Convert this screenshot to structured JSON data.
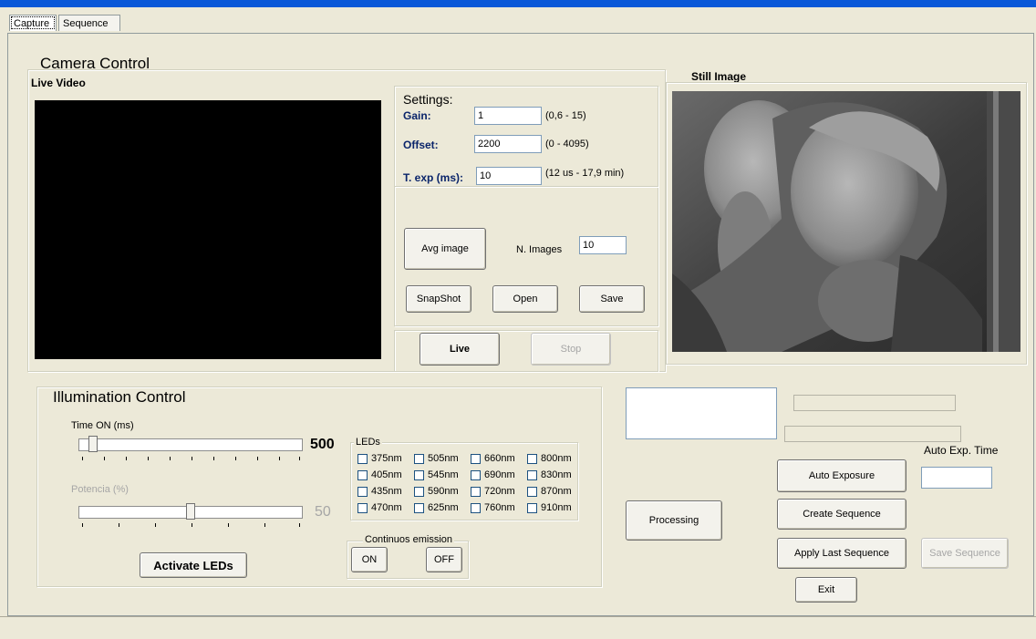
{
  "tabs": [
    "Capture",
    "Sequence"
  ],
  "camera_control": {
    "title": "Camera Control",
    "live_video_label": "Live Video",
    "still_image_label": "Still Image"
  },
  "settings": {
    "title": "Settings:",
    "gain_label": "Gain:",
    "gain_value": "1",
    "gain_range": "(0,6 - 15)",
    "offset_label": "Offset:",
    "offset_value": "2200",
    "offset_range": "(0 - 4095)",
    "texp_label": "T. exp (ms):",
    "texp_value": "10",
    "texp_range": "(12 us - 17,9 min)"
  },
  "capture_buttons": {
    "avg_image": "Avg image",
    "n_images_label": "N. Images",
    "n_images_value": "10",
    "snapshot": "SnapShot",
    "open": "Open",
    "save": "Save",
    "live": "Live",
    "stop": "Stop"
  },
  "illumination": {
    "title": "Illumination Control",
    "time_on_label": "Time ON (ms)",
    "time_on_value": "500",
    "time_on_level": 0.0,
    "potencia_label": "Potencia (%)",
    "potencia_value": "50",
    "potencia_level": 0.5,
    "activate_leds": "Activate LEDs",
    "leds_label": "LEDs",
    "leds": [
      [
        "375nm",
        "505nm",
        "660nm",
        "800nm"
      ],
      [
        "405nm",
        "545nm",
        "690nm",
        "830nm"
      ],
      [
        "435nm",
        "590nm",
        "720nm",
        "870nm"
      ],
      [
        "470nm",
        "625nm",
        "760nm",
        "910nm"
      ]
    ],
    "continuous_label": "Continuos emission",
    "on": "ON",
    "off": "OFF"
  },
  "right_panel": {
    "processing": "Processing",
    "auto_exp_time_label": "Auto Exp. Time",
    "auto_exposure": "Auto Exposure",
    "create_sequence": "Create Sequence",
    "apply_last_sequence": "Apply Last Sequence",
    "save_sequence": "Save Sequence",
    "exit": "Exit"
  },
  "colors": {
    "window_bg": "#ece9d8",
    "label_navy": "#0a246a",
    "title_bar_blue": "#0a58d8"
  }
}
